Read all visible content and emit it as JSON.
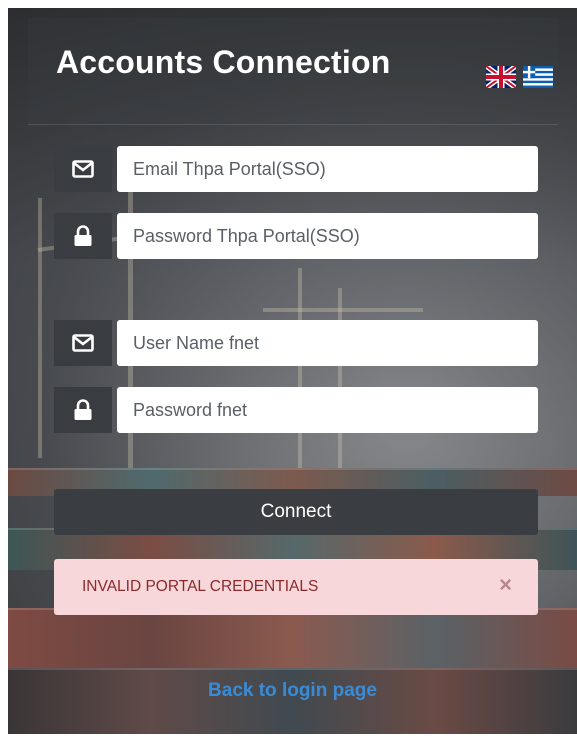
{
  "header": {
    "title": "Accounts Connection",
    "languages": [
      {
        "name": "english",
        "icon": "uk-flag-icon"
      },
      {
        "name": "greek",
        "icon": "greece-flag-icon"
      }
    ]
  },
  "portal_login": {
    "email_placeholder": "Email Thpa Portal(SSO)",
    "email_icon": "envelope-icon",
    "password_placeholder": "Password Thpa Portal(SSO)",
    "password_icon": "lock-icon"
  },
  "fnet_login": {
    "username_placeholder": "User Name fnet",
    "username_icon": "envelope-icon",
    "password_placeholder": "Password fnet",
    "password_icon": "lock-icon"
  },
  "actions": {
    "connect_label": "Connect"
  },
  "alert": {
    "message": "INVALID PORTAL CREDENTIALS",
    "close_symbol": "×"
  },
  "footer": {
    "back_link": "Back to login page"
  },
  "colors": {
    "icon_bg": "#393c40",
    "alert_bg": "#f7d7da",
    "alert_text": "#8a2a2d",
    "link": "#3a8bd6"
  }
}
